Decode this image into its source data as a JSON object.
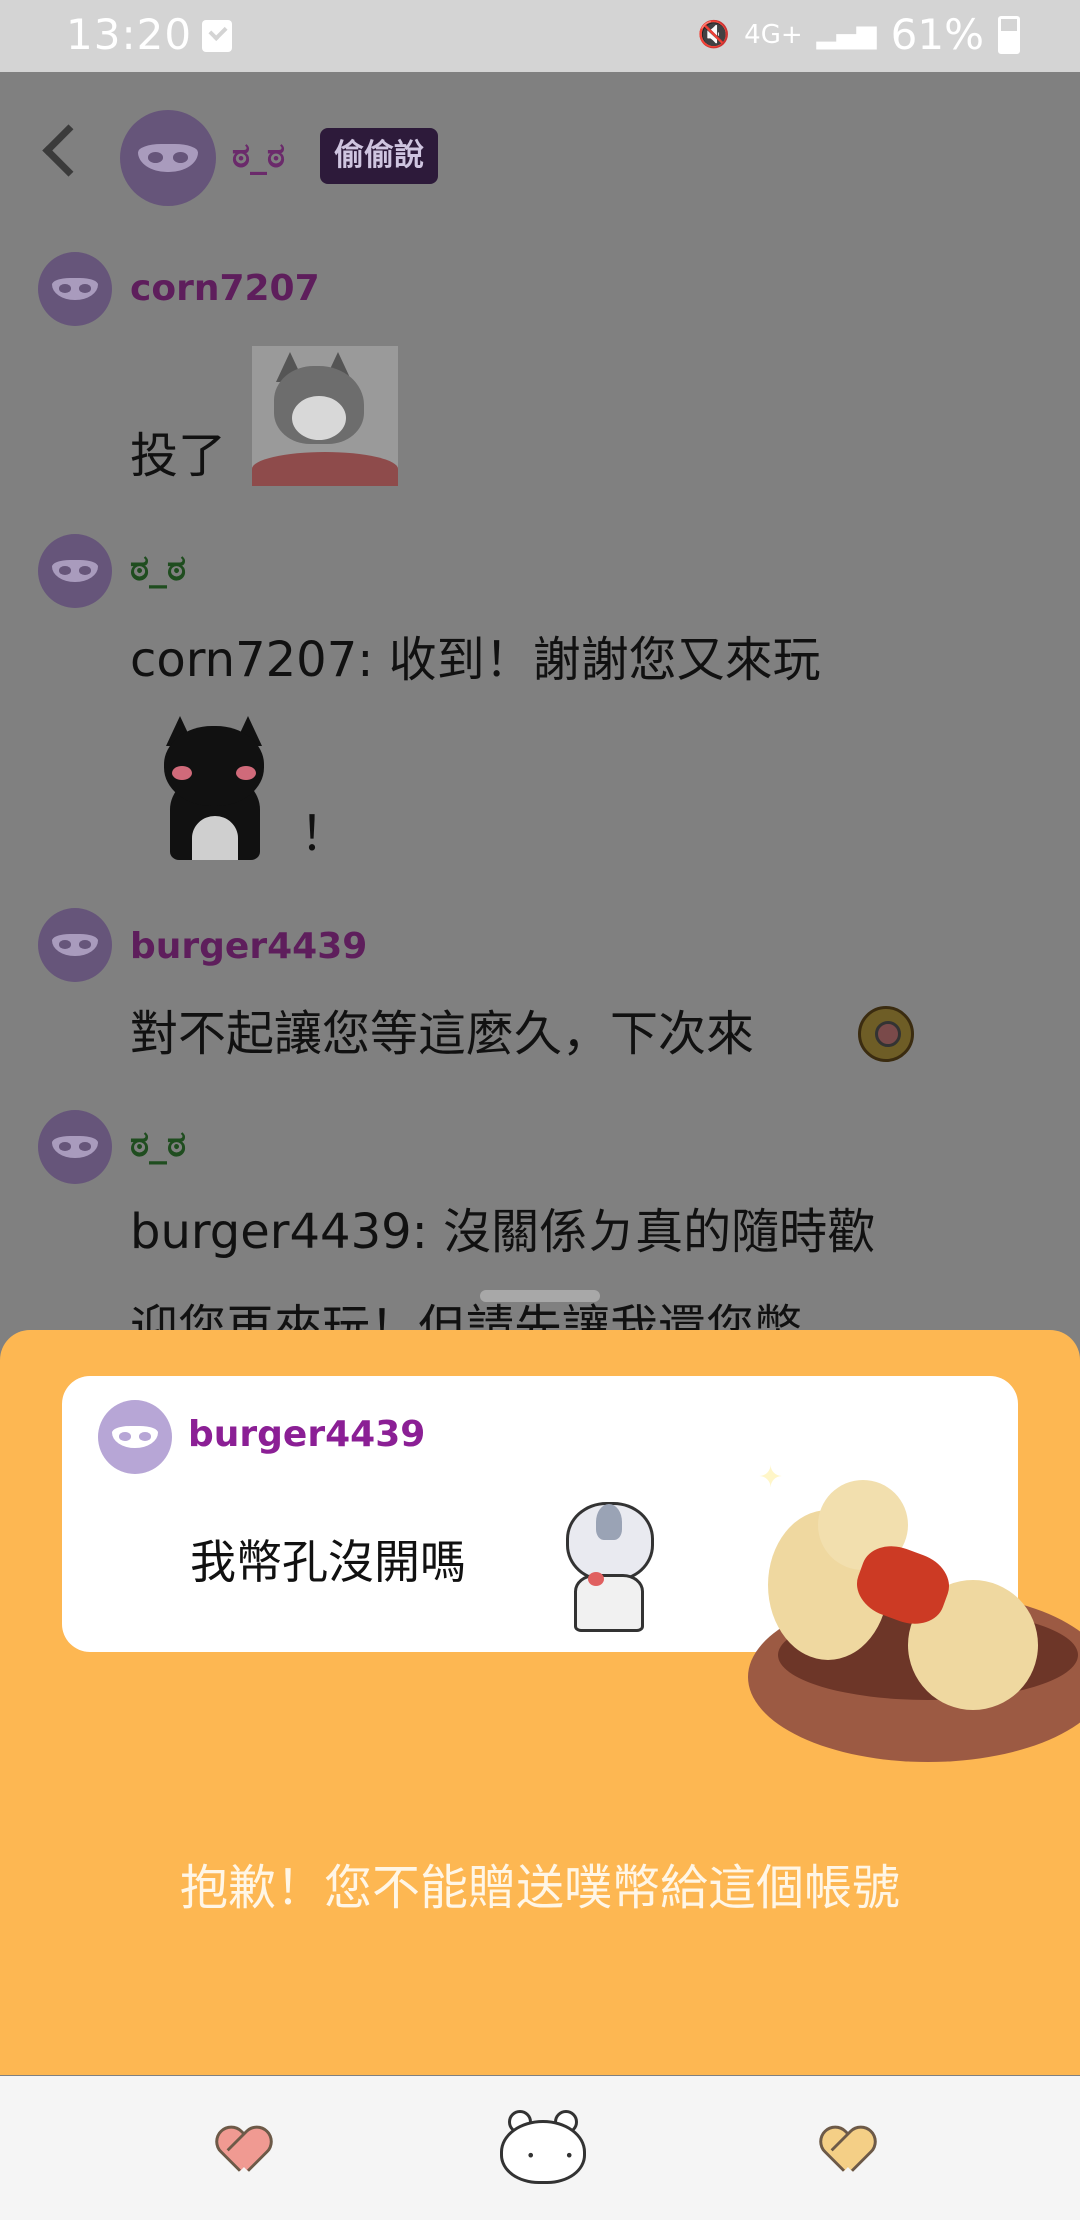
{
  "status_bar": {
    "time": "13:20",
    "network": "4G+",
    "battery": "61%"
  },
  "header": {
    "name": "ಠ_ಠ",
    "badge": "偷偷說"
  },
  "messages": [
    {
      "name": "corn7207",
      "text": "投了",
      "sticker": "husky-sticker"
    },
    {
      "name": "ಠ_ಠ",
      "text": "corn7207: 收到！謝謝您又來玩",
      "text2": "！",
      "sticker": "black-cat-sticker"
    },
    {
      "name": "burger4439",
      "text": "對不起讓您等這麼久，下次來",
      "emoji": "dizzy-face-emoji"
    },
    {
      "name": "ಠ_ಠ",
      "text": "burger4439: 沒關係ㄉ真的隨時歡",
      "text2": "迎您再來玩！但請先讓我還您幣"
    }
  ],
  "sheet": {
    "card_name": "burger4439",
    "card_text": "我幣孔沒開嗎",
    "message": "抱歉！您不能贈送噗幣給這個帳號"
  },
  "colors": {
    "sheet_bg": "#fdb752",
    "name_purple": "#5e1e5c",
    "name_green": "#1f4d1f",
    "card_name": "#8b1f95"
  }
}
